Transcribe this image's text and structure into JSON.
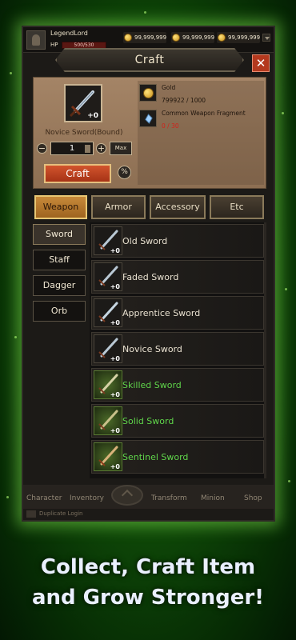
{
  "hud": {
    "player_name": "LegendLord",
    "hp_label": "HP",
    "hp_value": "500/530",
    "currencies": [
      "99,999,999",
      "99,999,999",
      "99,999,999"
    ]
  },
  "craft": {
    "title": "Craft",
    "close_label": "✕",
    "selected_item": {
      "name": "Novice Sword(Bound)",
      "count": "+0"
    },
    "quantity": "1",
    "max_label": "Max",
    "craft_label": "Craft",
    "percent_label": "%",
    "requirements": [
      {
        "name": "Gold",
        "value": "799922 / 1000",
        "ok": true
      },
      {
        "name": "Common Weapon Fragment",
        "value": "0 / 30",
        "ok": false
      }
    ]
  },
  "tabs": [
    "Weapon",
    "Armor",
    "Accessory",
    "Etc"
  ],
  "subtabs": [
    "Sword",
    "Staff",
    "Dagger",
    "Orb"
  ],
  "items": [
    {
      "name": "Old Sword",
      "count": "+0",
      "tier": "normal"
    },
    {
      "name": "Faded Sword",
      "count": "+0",
      "tier": "normal"
    },
    {
      "name": "Apprentice Sword",
      "count": "+0",
      "tier": "normal"
    },
    {
      "name": "Novice Sword",
      "count": "+0",
      "tier": "normal"
    },
    {
      "name": "Skilled Sword",
      "count": "+0",
      "tier": "green"
    },
    {
      "name": "Solid Sword",
      "count": "+0",
      "tier": "green"
    },
    {
      "name": "Sentinel Sword",
      "count": "+0",
      "tier": "green"
    }
  ],
  "nav": [
    "Character",
    "Inventory",
    "Transform",
    "Minion",
    "Shop"
  ],
  "footer_note": "Duplicate Login",
  "promo": {
    "line1": "Collect, Craft Item",
    "line2": "and Grow Stronger!"
  },
  "colors": {
    "accent": "#c7893a",
    "green_tier": "#5fd44a",
    "craft_button": "#d2542d",
    "glow": "#96ff5a"
  }
}
